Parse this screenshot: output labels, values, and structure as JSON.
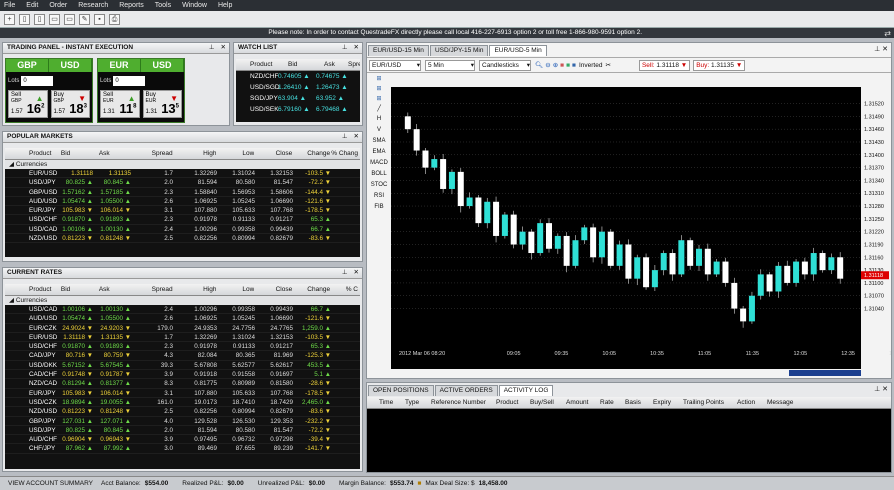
{
  "menu": [
    "File",
    "Edit",
    "Order",
    "Research",
    "Reports",
    "Tools",
    "Window",
    "Help"
  ],
  "notice": "Please note: In order to contact QuestradeFX directly please call local 416-227-6913 option 2 or toll free 1-866-980-9591 option 2.",
  "trading_panel": {
    "title": "TRADING PANEL - INSTANT EXECUTION",
    "cards": [
      {
        "base": "GBP",
        "quote": "USD",
        "lots_label": "Lots",
        "lots": "0",
        "sell_label": "Sell",
        "sell_ccy": "GBP",
        "sell_small": "1.57",
        "sell_big": "16",
        "sell_sup": "2",
        "buy_label": "Buy",
        "buy_ccy": "GBP",
        "buy_small": "1.57",
        "buy_big": "18",
        "buy_sup": "3"
      },
      {
        "base": "EUR",
        "quote": "USD",
        "lots_label": "Lots",
        "lots": "0",
        "sell_label": "Sell",
        "sell_ccy": "EUR",
        "sell_small": "1.31",
        "sell_big": "11",
        "sell_sup": "8",
        "buy_label": "Buy",
        "buy_ccy": "EUR",
        "buy_small": "1.31",
        "buy_big": "13",
        "buy_sup": "5"
      }
    ]
  },
  "watch_list": {
    "title": "WATCH LIST",
    "cols": [
      "Product",
      "Bid",
      "Ask",
      "Spre"
    ],
    "rows": [
      {
        "sym": "NZD/CHF",
        "bid": "0.74605 ▲",
        "ask": "0.74675 ▲"
      },
      {
        "sym": "USD/SGD",
        "bid": "1.26410 ▲",
        "ask": "1.26473 ▲"
      },
      {
        "sym": "SGD/JPY",
        "bid": "63.904 ▲",
        "ask": "63.952 ▲"
      },
      {
        "sym": "USD/SEK",
        "bid": "6.79160 ▲",
        "ask": "6.79468 ▲"
      }
    ]
  },
  "popular": {
    "title": "POPULAR MARKETS",
    "cols": [
      "Product",
      "Bid",
      "Ask",
      "Spread",
      "High",
      "Low",
      "Close",
      "Change",
      "% Chang"
    ],
    "group": "Currencies",
    "rows": [
      [
        "EUR/USD",
        "1.31118",
        "1.31135",
        "1.7",
        "1.32269",
        "1.31024",
        "1.32153",
        "-103.5 ▼"
      ],
      [
        "USD/JPY",
        "80.825 ▲",
        "80.845 ▲",
        "2.0",
        "81.594",
        "80.580",
        "81.547",
        "-72.2 ▼"
      ],
      [
        "GBP/USD",
        "1.57162 ▲",
        "1.57185 ▲",
        "2.3",
        "1.58840",
        "1.56953",
        "1.58606",
        "-144.4 ▼"
      ],
      [
        "AUD/USD",
        "1.05474 ▲",
        "1.05500 ▲",
        "2.6",
        "1.06925",
        "1.05245",
        "1.06690",
        "-121.6 ▼"
      ],
      [
        "EUR/JPY",
        "105.983 ▼",
        "106.014 ▼",
        "3.1",
        "107.880",
        "105.633",
        "107.768",
        "-178.5 ▼"
      ],
      [
        "USD/CHF",
        "0.91870 ▲",
        "0.91893 ▲",
        "2.3",
        "0.91978",
        "0.91133",
        "0.91217",
        "65.3 ▲"
      ],
      [
        "USD/CAD",
        "1.00106 ▲",
        "1.00130 ▲",
        "2.4",
        "1.00296",
        "0.99358",
        "0.99439",
        "66.7 ▲"
      ],
      [
        "NZD/USD",
        "0.81223 ▼",
        "0.81248 ▼",
        "2.5",
        "0.82256",
        "0.80994",
        "0.82679",
        "-83.6 ▼"
      ]
    ]
  },
  "current": {
    "title": "CURRENT RATES",
    "cols": [
      "Product",
      "Bid",
      "Ask",
      "Spread",
      "High",
      "Low",
      "Close",
      "Change",
      "% C"
    ],
    "group": "Currencies",
    "rows": [
      [
        "USD/CAD",
        "1.00106 ▲",
        "1.00130 ▲",
        "2.4",
        "1.00296",
        "0.99358",
        "0.99439",
        "66.7 ▲"
      ],
      [
        "AUD/USD",
        "1.05474 ▲",
        "1.05500 ▲",
        "2.6",
        "1.06925",
        "1.05245",
        "1.06690",
        "-121.6 ▼"
      ],
      [
        "EUR/CZK",
        "24.9024 ▼",
        "24.9203 ▼",
        "179.0",
        "24.9353",
        "24.7756",
        "24.7765",
        "1,259.0 ▲"
      ],
      [
        "EUR/USD",
        "1.31118 ▼",
        "1.31135 ▼",
        "1.7",
        "1.32269",
        "1.31024",
        "1.32153",
        "-103.5 ▼"
      ],
      [
        "USD/CHF",
        "0.91870 ▲",
        "0.91893 ▲",
        "2.3",
        "0.91978",
        "0.91133",
        "0.91217",
        "65.3 ▲"
      ],
      [
        "CAD/JPY",
        "80.716 ▼",
        "80.759 ▼",
        "4.3",
        "82.084",
        "80.365",
        "81.969",
        "-125.3 ▼"
      ],
      [
        "USD/DKK",
        "5.67152 ▲",
        "5.67545 ▲",
        "39.3",
        "5.67808",
        "5.62577",
        "5.62617",
        "453.5 ▲"
      ],
      [
        "CAD/CHF",
        "0.91748 ▼",
        "0.91787 ▼",
        "3.9",
        "0.91918",
        "0.91558",
        "0.91697",
        "5.1 ▲"
      ],
      [
        "NZD/CAD",
        "0.81294 ▲",
        "0.81377 ▲",
        "8.3",
        "0.81775",
        "0.80989",
        "0.81580",
        "-28.6 ▼"
      ],
      [
        "EUR/JPY",
        "105.983 ▼",
        "106.014 ▼",
        "3.1",
        "107.880",
        "105.633",
        "107.768",
        "-178.5 ▼"
      ],
      [
        "USD/CZK",
        "18.9894 ▲",
        "19.0055 ▲",
        "161.0",
        "19.0173",
        "18.7410",
        "18.7429",
        "2,465.0 ▲"
      ],
      [
        "NZD/USD",
        "0.81223 ▼",
        "0.81248 ▼",
        "2.5",
        "0.82256",
        "0.80994",
        "0.82679",
        "-83.6 ▼"
      ],
      [
        "GBP/JPY",
        "127.031 ▲",
        "127.071 ▲",
        "4.0",
        "129.528",
        "126.530",
        "129.353",
        "-232.2 ▼"
      ],
      [
        "USD/JPY",
        "80.825 ▲",
        "80.845 ▲",
        "2.0",
        "81.594",
        "80.580",
        "81.547",
        "-72.2 ▼"
      ],
      [
        "AUD/CHF",
        "0.96904 ▼",
        "0.96943 ▼",
        "3.9",
        "0.97495",
        "0.96732",
        "0.97298",
        "-39.4 ▼"
      ],
      [
        "CHF/JPY",
        "87.962 ▲",
        "87.992 ▲",
        "3.0",
        "89.469",
        "87.655",
        "89.239",
        "-141.7 ▼"
      ]
    ]
  },
  "chart_panel": {
    "tabs": [
      "EUR/USD-15 Min",
      "USD/JPY-15 Min",
      "EUR/USD-5 Min"
    ],
    "symbol": "EUR/USD",
    "interval": "5 Min",
    "style": "Candlesticks",
    "inverted_label": "Inverted",
    "sell_label": "Sell:",
    "sell_price": "1.31118",
    "buy_label": "Buy:",
    "buy_price": "1.31135",
    "tools": [
      "H",
      "V",
      "SMA",
      "EMA",
      "MACD",
      "BOLL",
      "STOC",
      "RSI",
      "FIB"
    ]
  },
  "chart_data": {
    "type": "candlestick",
    "title": "",
    "xlabel": "",
    "ylabel": "",
    "ylim": [
      1.3095,
      1.3154
    ],
    "y_ticks": [
      "1.31520",
      "1.31490",
      "1.31460",
      "1.31430",
      "1.31400",
      "1.31370",
      "1.31340",
      "1.31310",
      "1.31280",
      "1.31250",
      "1.31220",
      "1.31190",
      "1.31160",
      "1.31130",
      "1.31100",
      "1.31070",
      "1.31040"
    ],
    "current_price": "1.31118",
    "x_ticks": [
      "2012 Mar 06 08:20",
      "09:05",
      "09:35",
      "10:05",
      "10:35",
      "11:05",
      "11:35",
      "12:05",
      "12:35",
      "13:05"
    ],
    "candles_close": [
      1.3149,
      1.3146,
      1.3141,
      1.3137,
      1.3139,
      1.3132,
      1.3136,
      1.3128,
      1.313,
      1.3124,
      1.3129,
      1.3121,
      1.3126,
      1.3119,
      1.3122,
      1.3117,
      1.3124,
      1.3118,
      1.3121,
      1.3114,
      1.312,
      1.3123,
      1.3116,
      1.3122,
      1.3114,
      1.3119,
      1.3111,
      1.3116,
      1.3109,
      1.3113,
      1.3117,
      1.3112,
      1.312,
      1.3114,
      1.3118,
      1.3112,
      1.3115,
      1.311,
      1.3104,
      1.3101,
      1.3107,
      1.3112,
      1.3108,
      1.3114,
      1.311,
      1.3115,
      1.3112,
      1.3117,
      1.3113,
      1.3116,
      1.3111
    ]
  },
  "orders": {
    "tabs": [
      "OPEN POSITIONS",
      "ACTIVE ORDERS",
      "ACTIVITY LOG"
    ],
    "cols": [
      "Time",
      "Type",
      "Reference Number",
      "Product",
      "Buy/Sell",
      "Amount",
      "Rate",
      "Basis",
      "Expiry",
      "Trailing Points",
      "Action",
      "Message"
    ]
  },
  "status": {
    "summary": "VIEW ACCOUNT SUMMARY",
    "acct_label": "Acct Balance:",
    "acct": "$554.00",
    "realized_label": "Realized P&L:",
    "realized": "$0.00",
    "unrealized_label": "Unrealized P&L:",
    "unrealized": "$0.00",
    "margin_label": "Margin Balance:",
    "margin": "$553.74",
    "maxdeal_label": "Max Deal Size: $",
    "maxdeal": "18,458.00"
  }
}
